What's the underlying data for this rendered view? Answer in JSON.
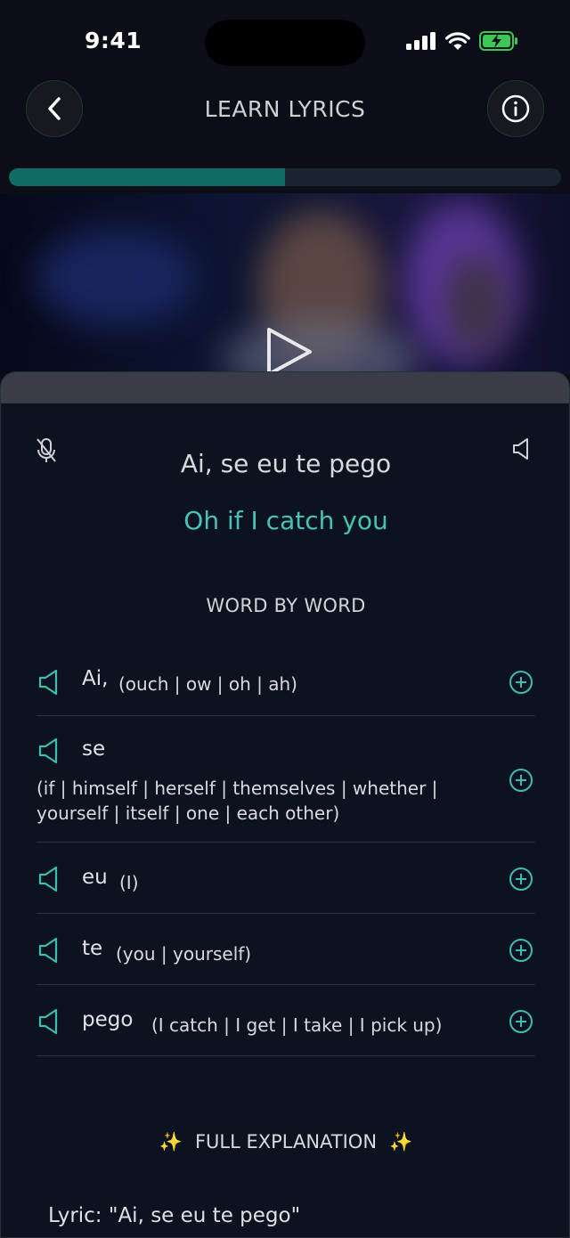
{
  "status_bar": {
    "time": "9:41"
  },
  "header": {
    "title": "LEARN LYRICS"
  },
  "progress": {
    "fraction": 0.5
  },
  "lyric": {
    "original": "Ai, se eu te pego",
    "translation": "Oh if I catch you"
  },
  "word_by_word": {
    "label": "WORD BY WORD",
    "items": [
      {
        "word": "Ai,",
        "meaning": "(ouch | ow | oh | ah)"
      },
      {
        "word": "se",
        "meaning_line1": "(if | himself | herself | themselves | whether |",
        "meaning_line2": "yourself | itself | one | each other)"
      },
      {
        "word": "eu",
        "meaning": "(I)"
      },
      {
        "word": "te",
        "meaning": "(you | yourself)"
      },
      {
        "word": "pego",
        "meaning": "(I catch | I get | I take | I pick up)"
      }
    ]
  },
  "full_explanation": {
    "label": "FULL EXPLANATION",
    "sparkle": "✨",
    "text": "Lyric: \"Ai, se eu te pego\""
  },
  "colors": {
    "accent": "#45c4b5",
    "progress": "#0f6b64",
    "background": "#0b0e17"
  },
  "icons": [
    "back-chevron-icon",
    "info-icon",
    "play-icon",
    "mic-off-icon",
    "speaker-icon",
    "plus-circle-icon",
    "sparkle-icon"
  ]
}
